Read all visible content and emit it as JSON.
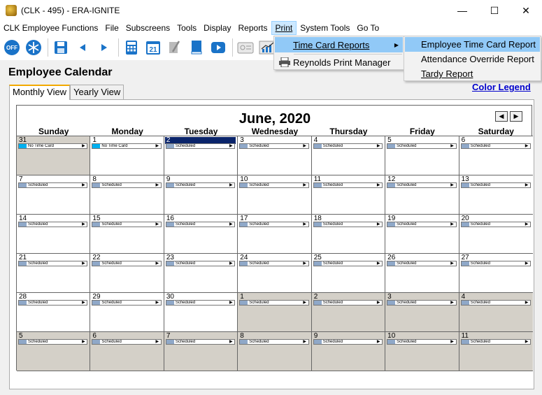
{
  "window": {
    "title": "(CLK - 495) - ERA-IGNITE",
    "minimize": "—",
    "maximize": "☐",
    "close": "✕"
  },
  "menubar": {
    "items": [
      {
        "label": "CLK Employee Functions"
      },
      {
        "label": "File"
      },
      {
        "label": "Subscreens"
      },
      {
        "label": "Tools"
      },
      {
        "label": "Display"
      },
      {
        "label": "Reports"
      },
      {
        "label": "Print"
      },
      {
        "label": "System Tools"
      },
      {
        "label": "Go To"
      }
    ]
  },
  "toolbar": {
    "off_label": "OFF",
    "calendar_day": "21"
  },
  "print_menu": {
    "items": [
      {
        "label": "Time Card Reports",
        "icon": "none",
        "highlighted": true
      },
      {
        "label": "Reynolds Print Manager",
        "icon": "printer-icon",
        "highlighted": false
      }
    ]
  },
  "time_card_submenu": {
    "items": [
      {
        "label": "Employee Time Card Report",
        "highlighted": true
      },
      {
        "label": "Attendance Override Report",
        "highlighted": false
      },
      {
        "label": "Tardy Report",
        "highlighted": false
      }
    ]
  },
  "page": {
    "title": "Employee Calendar",
    "color_legend": "Color Legend"
  },
  "tabs": [
    {
      "label": "Monthly View",
      "active": true
    },
    {
      "label": "Yearly View",
      "active": false
    }
  ],
  "calendar": {
    "month_title": "June, 2020",
    "prev": "◀",
    "next": "▶",
    "day_names": [
      "Sunday",
      "Monday",
      "Tuesday",
      "Wednesday",
      "Thursday",
      "Friday",
      "Saturday"
    ],
    "colors": {
      "today_bar": "#0a246a",
      "no_time_card": "#00b0f0",
      "scheduled": "#8fa8c8",
      "other_month": "#d4d0c8"
    },
    "cells": [
      {
        "day": "31",
        "status": "No Time Card",
        "other": true
      },
      {
        "day": "1",
        "status": "No Time Card",
        "other": false
      },
      {
        "day": "2",
        "status": "Scheduled",
        "other": false,
        "today": true
      },
      {
        "day": "3",
        "status": "Scheduled",
        "other": false
      },
      {
        "day": "4",
        "status": "Scheduled",
        "other": false
      },
      {
        "day": "5",
        "status": "Scheduled",
        "other": false
      },
      {
        "day": "6",
        "status": "Scheduled",
        "other": false
      },
      {
        "day": "7",
        "status": "Scheduled",
        "other": false
      },
      {
        "day": "8",
        "status": "Scheduled",
        "other": false
      },
      {
        "day": "9",
        "status": "Scheduled",
        "other": false
      },
      {
        "day": "10",
        "status": "Scheduled",
        "other": false
      },
      {
        "day": "11",
        "status": "Scheduled",
        "other": false
      },
      {
        "day": "12",
        "status": "Scheduled",
        "other": false
      },
      {
        "day": "13",
        "status": "Scheduled",
        "other": false
      },
      {
        "day": "14",
        "status": "Scheduled",
        "other": false
      },
      {
        "day": "15",
        "status": "Scheduled",
        "other": false
      },
      {
        "day": "16",
        "status": "Scheduled",
        "other": false
      },
      {
        "day": "17",
        "status": "Scheduled",
        "other": false
      },
      {
        "day": "18",
        "status": "Scheduled",
        "other": false
      },
      {
        "day": "19",
        "status": "Scheduled",
        "other": false
      },
      {
        "day": "20",
        "status": "Scheduled",
        "other": false
      },
      {
        "day": "21",
        "status": "Scheduled",
        "other": false
      },
      {
        "day": "22",
        "status": "Scheduled",
        "other": false
      },
      {
        "day": "23",
        "status": "Scheduled",
        "other": false
      },
      {
        "day": "24",
        "status": "Scheduled",
        "other": false
      },
      {
        "day": "25",
        "status": "Scheduled",
        "other": false
      },
      {
        "day": "26",
        "status": "Scheduled",
        "other": false
      },
      {
        "day": "27",
        "status": "Scheduled",
        "other": false
      },
      {
        "day": "28",
        "status": "Scheduled",
        "other": false
      },
      {
        "day": "29",
        "status": "Scheduled",
        "other": false
      },
      {
        "day": "30",
        "status": "Scheduled",
        "other": false
      },
      {
        "day": "1",
        "status": "Scheduled",
        "other": true
      },
      {
        "day": "2",
        "status": "Scheduled",
        "other": true
      },
      {
        "day": "3",
        "status": "Scheduled",
        "other": true
      },
      {
        "day": "4",
        "status": "Scheduled",
        "other": true
      },
      {
        "day": "5",
        "status": "Scheduled",
        "other": true
      },
      {
        "day": "6",
        "status": "Scheduled",
        "other": true
      },
      {
        "day": "7",
        "status": "Scheduled",
        "other": true
      },
      {
        "day": "8",
        "status": "Scheduled",
        "other": true
      },
      {
        "day": "9",
        "status": "Scheduled",
        "other": true
      },
      {
        "day": "10",
        "status": "Scheduled",
        "other": true
      },
      {
        "day": "11",
        "status": "Scheduled",
        "other": true
      }
    ]
  }
}
